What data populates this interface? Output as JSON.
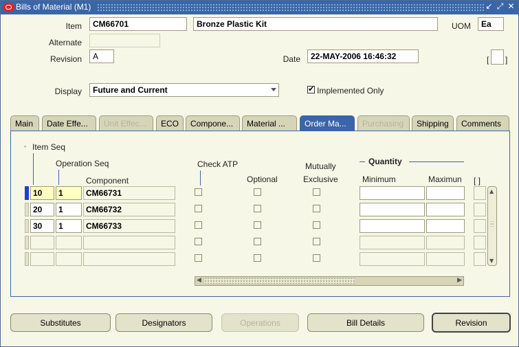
{
  "window": {
    "title": "Bills of Material (M1)",
    "controls": [
      "↙",
      "⤢",
      "✕"
    ]
  },
  "header": {
    "item_label": "Item",
    "item_value": "CM66701",
    "description_value": "Bronze Plastic Kit",
    "uom_label": "UOM",
    "uom_value": "Ea",
    "alternate_label": "Alternate",
    "alternate_value": "",
    "revision_label": "Revision",
    "revision_value": "A",
    "date_label": "Date",
    "date_value": "22-MAY-2006 16:46:32",
    "flex_label": "[",
    "flex_label_end": "]",
    "display_label": "Display",
    "display_value": "Future and Current",
    "implemented_only_label": "Implemented Only",
    "implemented_only_checked": true
  },
  "tabs": [
    {
      "label": "Main",
      "state": "normal"
    },
    {
      "label": "Date Effe...",
      "state": "normal"
    },
    {
      "label": "Unit Effec...",
      "state": "disabled"
    },
    {
      "label": "ECO",
      "state": "normal"
    },
    {
      "label": "Compone...",
      "state": "normal"
    },
    {
      "label": "Material ...",
      "state": "normal"
    },
    {
      "label": "Order Ma...",
      "state": "active"
    },
    {
      "label": "Purchasing",
      "state": "disabled"
    },
    {
      "label": "Shipping",
      "state": "normal"
    },
    {
      "label": "Comments",
      "state": "normal"
    }
  ],
  "grid": {
    "item_seq_label": "Item Seq",
    "operation_seq_label": "Operation Seq",
    "component_label": "Component",
    "check_atp_label": "Check ATP",
    "optional_label": "Optional",
    "mutually_label": "Mutually",
    "exclusive_label": "Exclusive",
    "quantity_label": "Quantity",
    "minimum_label": "Minimum",
    "maximum_label": "Maximun",
    "flex_label": "[ ]",
    "rows": [
      {
        "item_seq": "10",
        "op_seq": "1",
        "component": "CM66731"
      },
      {
        "item_seq": "20",
        "op_seq": "1",
        "component": "CM66732"
      },
      {
        "item_seq": "30",
        "op_seq": "1",
        "component": "CM66733"
      },
      {
        "item_seq": "",
        "op_seq": "",
        "component": ""
      },
      {
        "item_seq": "",
        "op_seq": "",
        "component": ""
      }
    ]
  },
  "buttons": {
    "substitutes": "Substitutes",
    "designators": "Designators",
    "operations": "Operations",
    "bill_details": "Bill Details",
    "revision": "Revision"
  }
}
